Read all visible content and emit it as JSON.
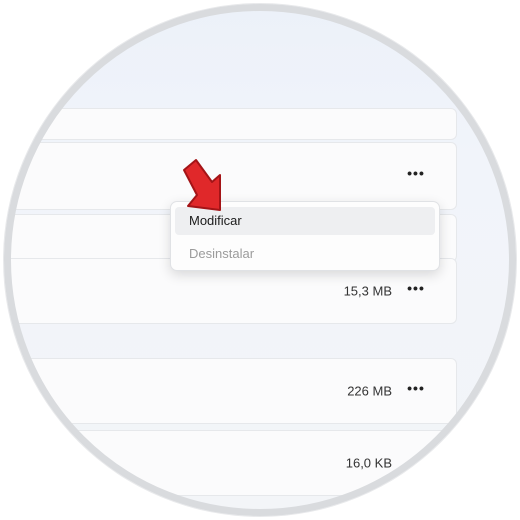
{
  "apps": {
    "rows": [
      {
        "size": "",
        "has_more": false
      },
      {
        "size": "",
        "has_more": true
      },
      {
        "size": "",
        "has_more": false
      },
      {
        "size": "15,3 MB",
        "has_more": true
      },
      {
        "size": "226 MB",
        "has_more": true
      },
      {
        "size": "16,0 KB",
        "has_more": false
      }
    ],
    "more_glyph": "•••"
  },
  "context_menu": {
    "items": [
      {
        "label": "Modificar",
        "state": "hovered"
      },
      {
        "label": "Desinstalar",
        "state": "disabled"
      }
    ]
  },
  "colors": {
    "annotation_arrow": "#e0282a",
    "menu_hover": "#eeeff1"
  }
}
